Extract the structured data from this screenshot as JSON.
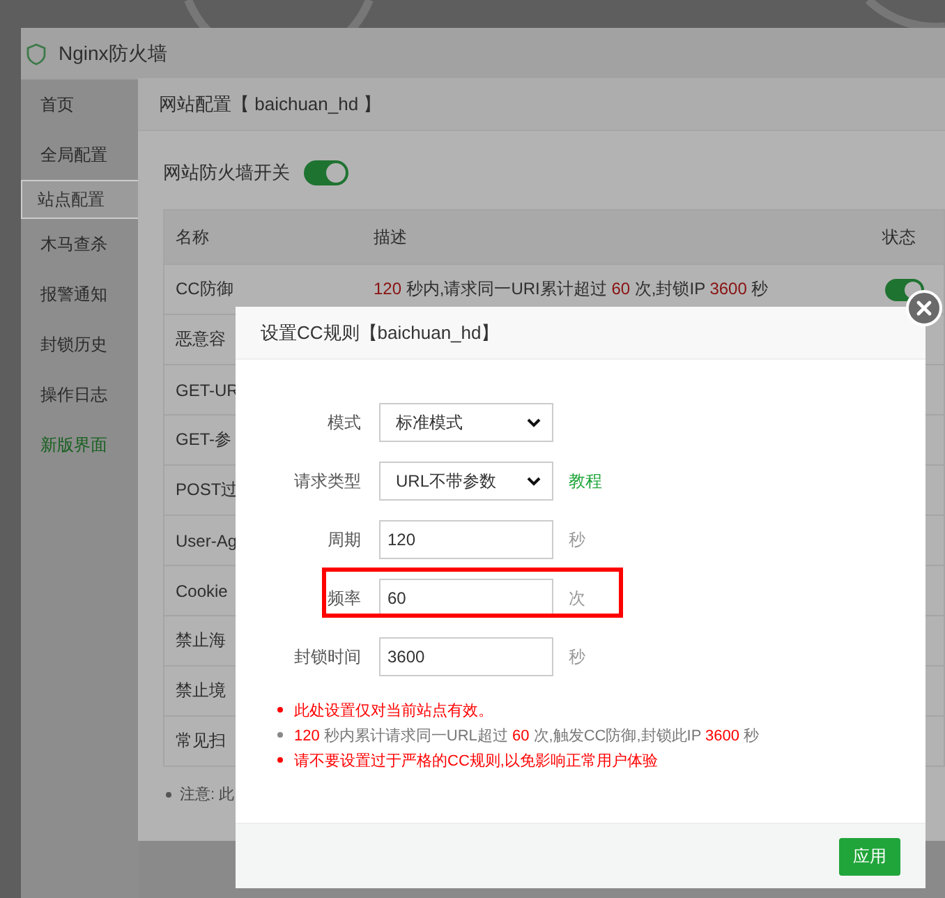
{
  "app": {
    "title": "Nginx防火墙"
  },
  "sidebar": {
    "items": [
      {
        "label": "首页",
        "selected": false,
        "kind": "normal"
      },
      {
        "label": "全局配置",
        "selected": false,
        "kind": "normal"
      },
      {
        "label": "站点配置",
        "selected": true,
        "kind": "normal"
      },
      {
        "label": "木马查杀",
        "selected": false,
        "kind": "normal"
      },
      {
        "label": "报警通知",
        "selected": false,
        "kind": "normal"
      },
      {
        "label": "封锁历史",
        "selected": false,
        "kind": "normal"
      },
      {
        "label": "操作日志",
        "selected": false,
        "kind": "normal"
      },
      {
        "label": "新版界面",
        "selected": false,
        "kind": "highlight"
      }
    ]
  },
  "site_config_dialog": {
    "title": "网站配置【 baichuan_hd 】",
    "firewall_switch": {
      "label": "网站防火墙开关",
      "on": true
    },
    "table": {
      "columns": [
        "名称",
        "描述",
        "状态"
      ],
      "rows": [
        {
          "name": "CC防御",
          "description": [
            {
              "kind": "value",
              "text": "120"
            },
            {
              "kind": "text",
              "text": " 秒内,请求同一URI累计超过 "
            },
            {
              "kind": "value",
              "text": "60"
            },
            {
              "kind": "text",
              "text": " 次,封锁IP "
            },
            {
              "kind": "value",
              "text": "3600"
            },
            {
              "kind": "text",
              "text": " 秒"
            }
          ],
          "enabled": true
        },
        {
          "name": "恶意容"
        },
        {
          "name": "GET-UR"
        },
        {
          "name": "GET-参"
        },
        {
          "name": "POST过"
        },
        {
          "name": "User-Ag"
        },
        {
          "name": "Cookie"
        },
        {
          "name": "禁止海"
        },
        {
          "name": "禁止境"
        },
        {
          "name": "常见扫"
        }
      ]
    },
    "note": "注意: 此"
  },
  "cc_rule_dialog": {
    "title": "设置CC规则【baichuan_hd】",
    "fields": [
      {
        "label": "模式",
        "kind": "select",
        "value": "标准模式",
        "highlighted": false
      },
      {
        "label": "请求类型",
        "kind": "select",
        "value": "URL不带参数",
        "link": "教程",
        "highlighted": false
      },
      {
        "label": "周期",
        "kind": "input",
        "value": "120",
        "unit": "秒",
        "highlighted": false
      },
      {
        "label": "频率",
        "kind": "input",
        "value": "60",
        "unit": "次",
        "highlighted": true
      },
      {
        "label": "封锁时间",
        "kind": "input",
        "value": "3600",
        "unit": "秒",
        "highlighted": false
      }
    ],
    "notes": [
      {
        "kind": "warning",
        "parts": [
          {
            "kind": "text",
            "text": "此处设置仅对当前站点有效。"
          }
        ]
      },
      {
        "kind": "info",
        "parts": [
          {
            "kind": "value",
            "text": "120"
          },
          {
            "kind": "text",
            "text": " 秒内累计请求同一URL超过 "
          },
          {
            "kind": "value",
            "text": "60"
          },
          {
            "kind": "text",
            "text": " 次,触发CC防御,封锁此IP "
          },
          {
            "kind": "value",
            "text": "3600"
          },
          {
            "kind": "text",
            "text": " 秒"
          }
        ]
      },
      {
        "kind": "warning",
        "parts": [
          {
            "kind": "text",
            "text": "请不要设置过于严格的CC规则,以免影响正常用户体验"
          }
        ]
      }
    ],
    "apply_button": "应用"
  }
}
